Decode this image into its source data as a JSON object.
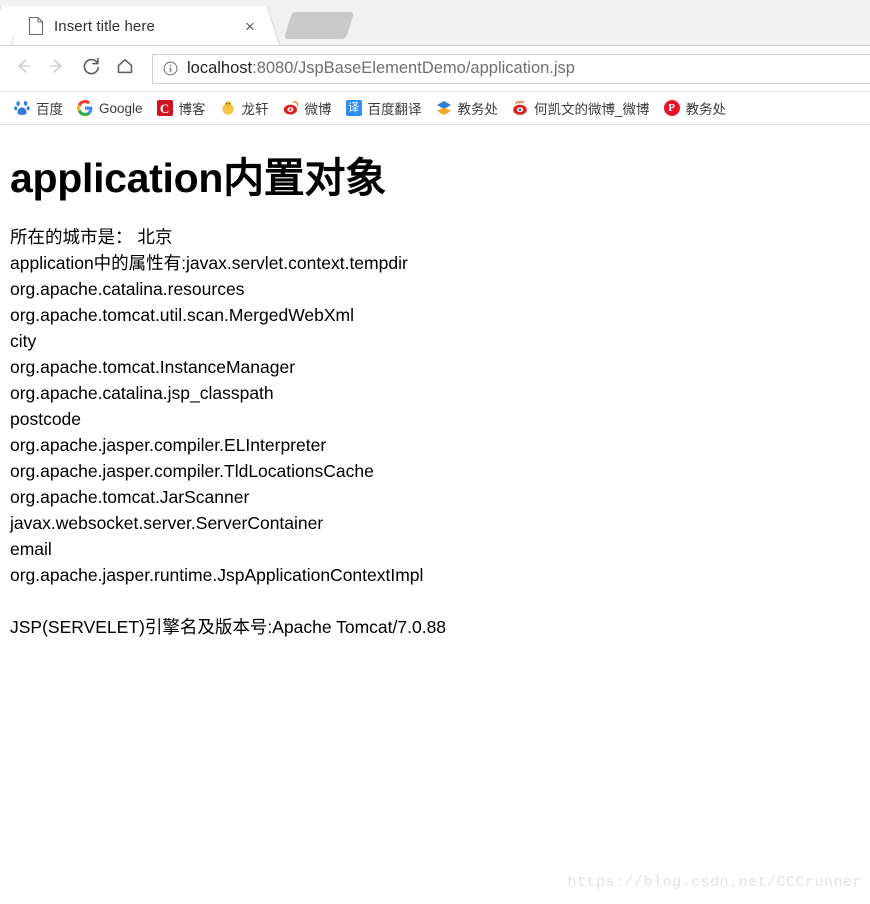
{
  "browser": {
    "tab": {
      "title": "Insert title here",
      "favicon": "document-icon",
      "close_label": "×"
    },
    "ghost_tab": {
      "name": "new-tab-placeholder"
    },
    "toolbar": {
      "back_label": "←",
      "forward_label": "→",
      "reload_label": "⟳",
      "home_label": "⌂",
      "info_label": "ⓘ",
      "url_host": "localhost",
      "url_rest": ":8080/JspBaseElementDemo/application.jsp",
      "url_full": "localhost:8080/JspBaseElementDemo/application.jsp"
    },
    "bookmarks": [
      {
        "label": "百度",
        "icon": "baidu-icon",
        "glyph": "熊",
        "cls": "ico-baidu"
      },
      {
        "label": "Google",
        "icon": "google-icon",
        "glyph": "G",
        "cls": "ico-google"
      },
      {
        "label": "博客",
        "icon": "csdn-icon",
        "glyph": "C",
        "cls": "ico-csdn"
      },
      {
        "label": "龙轩",
        "icon": "chick-icon",
        "glyph": "🐥",
        "cls": "ico-chick"
      },
      {
        "label": "微博",
        "icon": "weibo-icon",
        "glyph": "◉",
        "cls": "ico-weibo"
      },
      {
        "label": "百度翻译",
        "icon": "translate-icon",
        "glyph": "译",
        "cls": "ico-fanyi"
      },
      {
        "label": "教务处",
        "icon": "school-icon",
        "glyph": "学",
        "cls": "ico-jwc"
      },
      {
        "label": "何凯文的微博_微博",
        "icon": "weibo-icon",
        "glyph": "◉",
        "cls": "ico-weibo2"
      },
      {
        "label": "教务处",
        "icon": "pptv-icon",
        "glyph": "P",
        "cls": "ico-jwc2"
      }
    ]
  },
  "page": {
    "heading": "application内置对象",
    "lines": [
      "所在的城市是： 北京",
      "application中的属性有:javax.servlet.context.tempdir",
      "org.apache.catalina.resources",
      "org.apache.tomcat.util.scan.MergedWebXml",
      "city",
      "org.apache.tomcat.InstanceManager",
      "org.apache.catalina.jsp_classpath",
      "postcode",
      "org.apache.jasper.compiler.ELInterpreter",
      "org.apache.jasper.compiler.TldLocationsCache",
      "org.apache.tomcat.JarScanner",
      "javax.websocket.server.ServerContainer",
      "email",
      "org.apache.jasper.runtime.JspApplicationContextImpl"
    ],
    "engine_line": "JSP(SERVELET)引擎名及版本号:Apache Tomcat/7.0.88",
    "watermark": "https://blog.csdn.net/CCCrunner"
  }
}
